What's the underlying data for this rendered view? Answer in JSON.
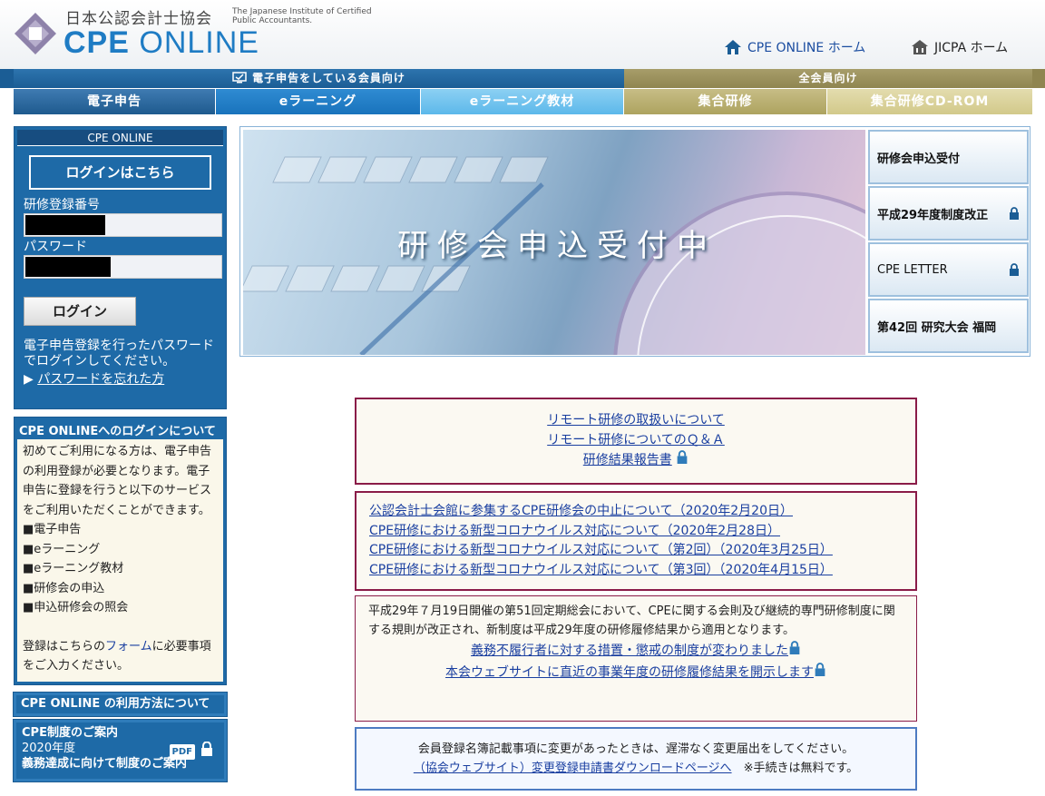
{
  "header": {
    "org_name_jp": "日本公認会計士協会",
    "org_name_en": "The Japanese Institute of Certified Public Accountants.",
    "brand_bold": "CPE",
    "brand_rest": " ONLINE",
    "links": [
      {
        "label": "CPE ONLINE ホーム",
        "icon": "home-icon"
      },
      {
        "label": "JICPA ホーム",
        "icon": "building-icon"
      }
    ]
  },
  "nav": {
    "group_left": "電子申告をしている会員向け",
    "group_right": "全会員向け",
    "tabs": [
      "電子申告",
      "eラーニング",
      "eラーニング教材",
      "集合研修",
      "集合研修CD-ROM"
    ]
  },
  "sidebar": {
    "box_title": "CPE ONLINE",
    "login_link": "ログインはこちら",
    "id_label": "研修登録番号",
    "pw_label": "パスワード",
    "login_button": "ログイン",
    "note": "電子申告登録を行ったパスワードでログインしてください。",
    "forgot_prefix": "▶ ",
    "forgot_link": "パスワードを忘れた方",
    "about": {
      "title": "CPE ONLINEへのログインについて",
      "intro": "初めてご利用になる方は、電子申告の利用登録が必要となります。電子申告に登録を行うと以下のサービスをご利用いただくことができます。",
      "items": [
        "■電子申告",
        "■eラーニング",
        "■eラーニング教材",
        "■研修会の申込",
        "■申込研修会の照会"
      ],
      "outro_pre": "登録はこちらの",
      "outro_link": "フォーム",
      "outro_post": "に必要事項をご入力ください。"
    },
    "usage_button": "CPE ONLINE の利用方法について",
    "cpe_guide": {
      "line1": "CPE制度のご案内",
      "line2": "2020年度",
      "line3": "義務達成に向けて制度のご案内",
      "badge": "PDF"
    }
  },
  "banner": {
    "title": "研修会申込受付中",
    "cards": [
      {
        "label": "研修会申込受付",
        "locked": false
      },
      {
        "label": "平成29年度制度改正",
        "locked": true
      },
      {
        "label": "CPE LETTER",
        "locked": true
      },
      {
        "label": "第42回 研究大会 福岡",
        "locked": false
      }
    ]
  },
  "notices": {
    "box1": [
      "リモート研修の取扱いについて",
      "リモート研修についてのＱ＆Ａ",
      "研修結果報告書"
    ],
    "box2": [
      "公認会計士会館に参集するCPE研修会の中止について（2020年2月20日）",
      "CPE研修における新型コロナウイルス対応について（2020年2月28日）",
      "CPE研修における新型コロナウイルス対応について（第2回）（2020年3月25日）",
      "CPE研修における新型コロナウイルス対応について（第3回）（2020年4月15日）"
    ],
    "box3": {
      "text": "平成29年７月19日開催の第51回定期総会において、CPEに関する会則及び継続的専門研修制度に関する規則が改正され、新制度は平成29年度の研修履修結果から適用となります。",
      "links": [
        "義務不履行者に対する措置・懲戒の制度が変わりました",
        "本会ウェブサイトに直近の事業年度の研修履修結果を開示します"
      ]
    },
    "box4": {
      "text": "会員登録名簿記載事項に変更があったときは、遅滞なく変更届出をしてください。",
      "link": "（協会ウェブサイト）変更登録申請書ダウンロードページへ",
      "note": "※手続きは無料です。"
    }
  }
}
